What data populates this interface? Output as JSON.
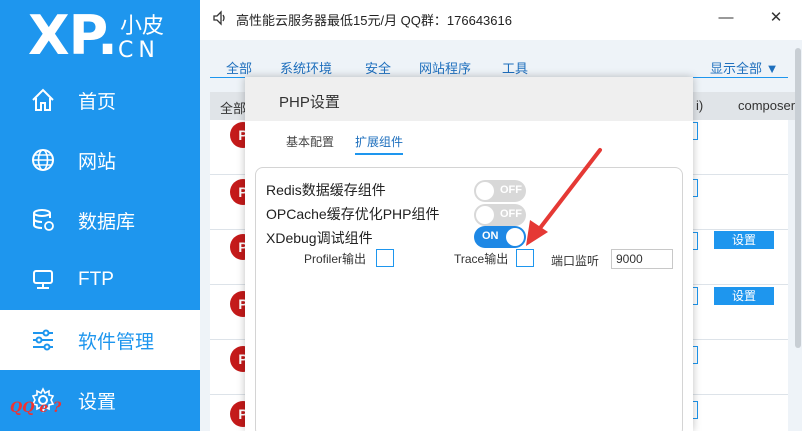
{
  "sidebar": {
    "logo": {
      "main": "XP.",
      "top": "小皮",
      "bottom": "CN"
    },
    "items": [
      {
        "label": "首页",
        "icon": "home-icon"
      },
      {
        "label": "网站",
        "icon": "globe-icon"
      },
      {
        "label": "数据库",
        "icon": "database-icon"
      },
      {
        "label": "FTP",
        "icon": "monitor-icon"
      },
      {
        "label": "软件管理",
        "icon": "sliders-icon"
      },
      {
        "label": "设置",
        "icon": "gear-icon"
      }
    ],
    "active_index": 4,
    "watermark": "QQ e ?"
  },
  "topbar": {
    "announcement": "高性能云服务器最低15元/月   QQ群：176643616",
    "minimize": "—",
    "close": "✕"
  },
  "main": {
    "tabs": [
      "全部",
      "系统环境",
      "安全",
      "网站程序",
      "工具"
    ],
    "show_all": "显示全部 ▼",
    "table_head": {
      "left": "全部",
      "paren": "i)",
      "composer": "composer"
    },
    "row_setting_label": "设置",
    "php_logo": "P"
  },
  "modal": {
    "title": "PHP设置",
    "tabs": [
      "基本配置",
      "扩展组件"
    ],
    "options": [
      {
        "label": "Redis数据缓存组件",
        "state": "OFF"
      },
      {
        "label": "OPCache缓存优化PHP组件",
        "state": "OFF"
      },
      {
        "label": "XDebug调试组件",
        "state": "ON"
      }
    ],
    "xdebug": {
      "profiler_label": "Profiler输出",
      "trace_label": "Trace输出",
      "port_label": "端口监听",
      "port_value": "9000"
    }
  },
  "colors": {
    "accent": "#1e96ee",
    "toggle_on": "#1e88e5",
    "arrow": "#e53935"
  }
}
